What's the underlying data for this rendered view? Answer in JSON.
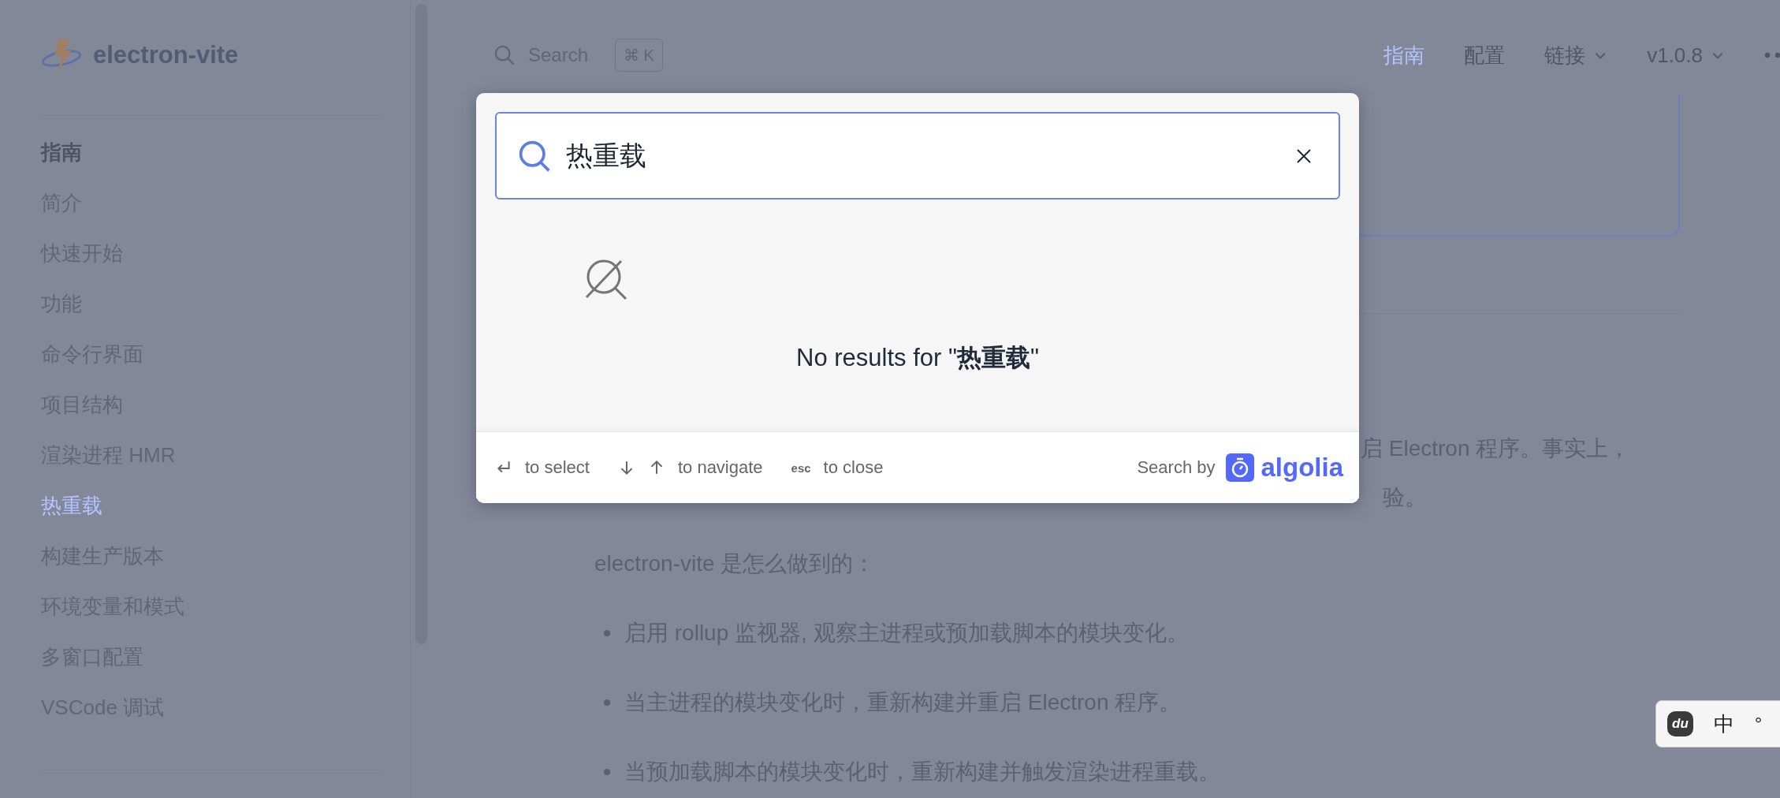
{
  "sidebar": {
    "logo": "electron-vite",
    "section": "指南",
    "items": [
      {
        "label": "简介",
        "selected": false
      },
      {
        "label": "快速开始",
        "selected": false
      },
      {
        "label": "功能",
        "selected": false
      },
      {
        "label": "命令行界面",
        "selected": false
      },
      {
        "label": "项目结构",
        "selected": false
      },
      {
        "label": "渲染进程 HMR",
        "selected": false
      },
      {
        "label": "热重载",
        "selected": true
      },
      {
        "label": "构建生产版本",
        "selected": false
      },
      {
        "label": "环境变量和模式",
        "selected": false
      },
      {
        "label": "多窗口配置",
        "selected": false
      },
      {
        "label": "VSCode 调试",
        "selected": false
      }
    ]
  },
  "header": {
    "search": {
      "placeholder": "Search",
      "shortcut": "⌘ K"
    },
    "nav": [
      {
        "label": "指南",
        "selected": true,
        "dropdown": false
      },
      {
        "label": "配置",
        "selected": false,
        "dropdown": false
      },
      {
        "label": "链接",
        "selected": false,
        "dropdown": true
      },
      {
        "label": "v1.0.8",
        "selected": false,
        "dropdown": true
      }
    ]
  },
  "content": {
    "fragments": [
      "启 Electron 程序。事实上，",
      "验。"
    ],
    "paragraph": "electron-vite 是怎么做到的：",
    "bullets": [
      "启用 rollup 监视器, 观察主进程或预加载脚本的模块变化。",
      "当主进程的模块变化时，重新构建并重启 Electron 程序。",
      "当预加载脚本的模块变化时，重新构建并触发渲染进程重载。"
    ]
  },
  "search_modal": {
    "query": "热重载",
    "message": "No results for \"**热重载**\"",
    "hints": [
      {
        "keys": [
          {
            "kind": "enter"
          }
        ],
        "label": "to select"
      },
      {
        "keys": [
          {
            "kind": "down"
          },
          {
            "kind": "up"
          }
        ],
        "label": "to navigate"
      },
      {
        "keys": [
          {
            "kind": "text",
            "text": "esc"
          }
        ],
        "label": "to close"
      }
    ],
    "search_by": "Search by",
    "brand": "algolia"
  },
  "ime": {
    "logo": "du",
    "mode": "中",
    "extra": "°"
  }
}
